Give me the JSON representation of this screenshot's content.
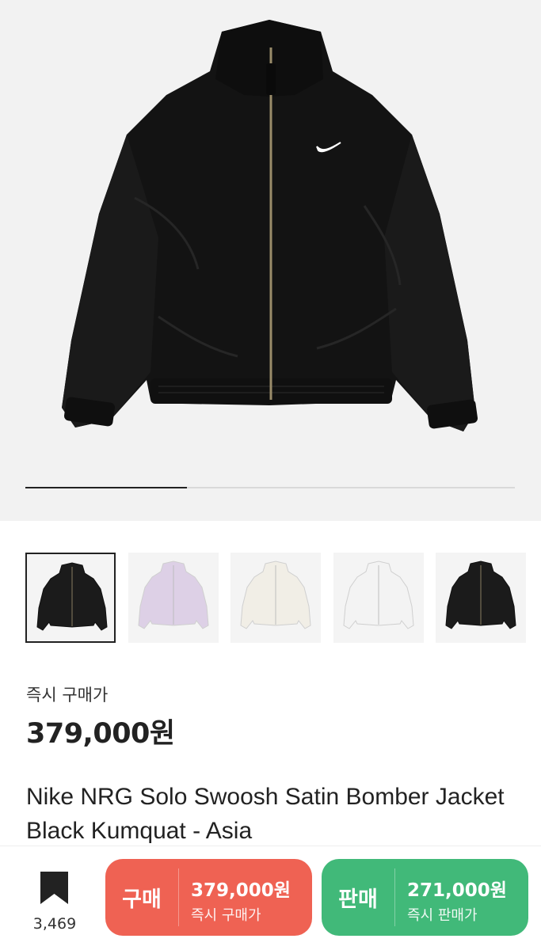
{
  "product": {
    "price_label": "즉시 구매가",
    "price": "379,000원",
    "title": "Nike NRG Solo Swoosh Satin Bomber Jacket Black Kumquat - Asia"
  },
  "gallery": {
    "progress": 0.33,
    "thumbnails": [
      {
        "color": "#1b1b1b",
        "selected": true
      },
      {
        "color": "#ddd0e6",
        "selected": false
      },
      {
        "color": "#f1eee6",
        "selected": false
      },
      {
        "color": "#f3f3f3",
        "selected": false
      },
      {
        "color": "#1b1b1b",
        "selected": false
      }
    ]
  },
  "bottom_bar": {
    "bookmark_count": "3,469",
    "buy": {
      "label": "구매",
      "price": "379,000원",
      "sub": "즉시 구매가"
    },
    "sell": {
      "label": "판매",
      "price": "271,000원",
      "sub": "즉시 판매가"
    }
  },
  "colors": {
    "buy": "#ef6253",
    "sell": "#41b979",
    "text": "#222222"
  }
}
